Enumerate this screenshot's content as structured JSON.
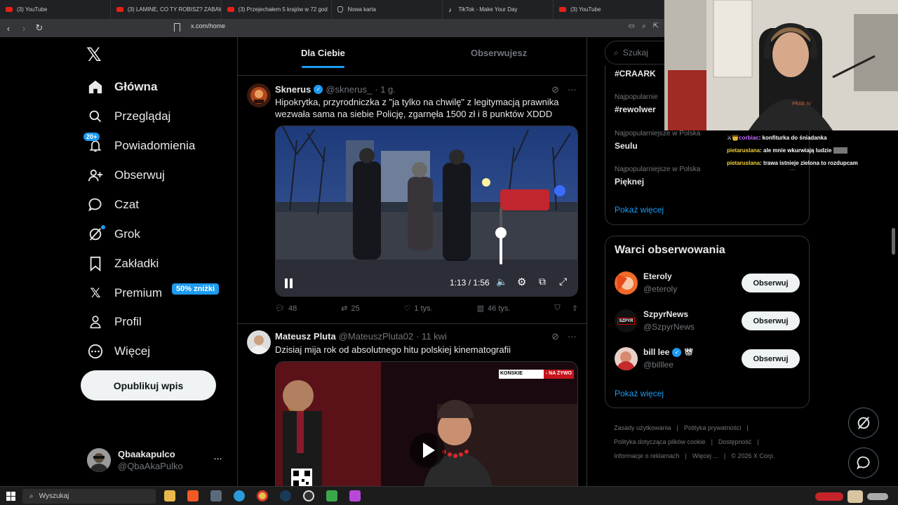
{
  "browser": {
    "tabs": [
      {
        "title": "(3) YouTube",
        "icon": "youtube-icon"
      },
      {
        "title": "(3) LAMINE, CO TY ROBISZ? ZABAW",
        "icon": "youtube-icon"
      },
      {
        "title": "(3) Przejechałem 5 krajów w 72 god",
        "icon": "youtube-icon"
      },
      {
        "title": "Nowa karta",
        "icon": "shield-icon"
      },
      {
        "title": "TikTok - Make Your Day",
        "icon": "tiktok-icon"
      },
      {
        "title": "(3) YouTube",
        "icon": "youtube-icon"
      }
    ],
    "url": "x.com/home"
  },
  "sidebar": {
    "items": [
      {
        "label": "Główna",
        "icon": "home-icon",
        "active": true
      },
      {
        "label": "Przeglądaj",
        "icon": "search-icon"
      },
      {
        "label": "Powiadomienia",
        "icon": "bell-icon",
        "badge": "20+"
      },
      {
        "label": "Obserwuj",
        "icon": "follow-icon"
      },
      {
        "label": "Czat",
        "icon": "chat-icon"
      },
      {
        "label": "Grok",
        "icon": "grok-icon"
      },
      {
        "label": "Zakładki",
        "icon": "bookmark-icon"
      },
      {
        "label": "Premium",
        "icon": "x-icon",
        "promo": "50% zniżki"
      },
      {
        "label": "Profil",
        "icon": "profile-icon"
      },
      {
        "label": "Więcej",
        "icon": "more-icon"
      }
    ],
    "post_button": "Opublikuj wpis",
    "account": {
      "name": "Qbaakapulco",
      "handle": "@QbaAkaPulko"
    }
  },
  "feed": {
    "tabs": [
      "Dla Ciebie",
      "Obserwujesz"
    ],
    "posts": [
      {
        "name": "Sknerus",
        "handle": "@sknerus_",
        "time": "· 1 g.",
        "text": "Hipokrytka, przyrodniczka z \"ja tylko na chwilę\" z legitymacją prawnika wezwała sama na siebie Policję, zgarnęła 1500 zł i 8 punktów XDDD",
        "video_time": "1:13 / 1:56",
        "volume": 0.55,
        "stats": {
          "replies": "48",
          "reposts": "25",
          "likes": "1 tys.",
          "views": "46 tys."
        }
      },
      {
        "name": "Mateusz Pluta",
        "handle": "@MateuszPluta02",
        "time": "· 11 kwi",
        "text": "Dzisiaj mija rok od absolutnego hitu polskiej kinematografii",
        "overlay_tag": "KOŃSKIE",
        "overlay_live": "- NA ŻYWO"
      }
    ]
  },
  "right": {
    "search_placeholder": "Szukaj",
    "trends": [
      {
        "category": "",
        "name": "#CRAARK"
      },
      {
        "category": "Najpopularnie",
        "name": "#rewolwer"
      },
      {
        "category": "Najpopularniejsze w Polska",
        "name": "Seulu"
      },
      {
        "category": "Najpopularniejsze w Polska",
        "name": "Pięknej"
      }
    ],
    "show_more": "Pokaż więcej",
    "wtf_title": "Warci obserwowania",
    "accounts": [
      {
        "name": "Eteroly",
        "handle": "@eteroly",
        "button": "Obserwuj"
      },
      {
        "name": "SzpyrNews",
        "handle": "@SzpyrNews",
        "button": "Obserwuj",
        "avatar_text": "SZPYR"
      },
      {
        "name": "bill lee",
        "handle": "@billlee",
        "button": "Obserwuj"
      }
    ],
    "wtf_more": "Pokaż więcej",
    "footer": [
      "Zasady użytkowania",
      "|",
      "Polityka prywatności",
      "|",
      "Polityka dotycząca plików cookie",
      "|",
      "Dostępność",
      "|",
      "Informacje o reklamach",
      "|",
      "Więcej ...",
      "|",
      "© 2026 X Corp."
    ]
  },
  "stream_chat": [
    {
      "user": "corbiac",
      "message": "konfiturka do śniadanka"
    },
    {
      "user": "pietaruslana",
      "message": "ale mnie wkurwiają ludzie"
    },
    {
      "user": "pietaruslana",
      "message": "trawa istnieje zielona to rozdupcam"
    }
  ],
  "taskbar": {
    "search": "Wyszukaj"
  }
}
